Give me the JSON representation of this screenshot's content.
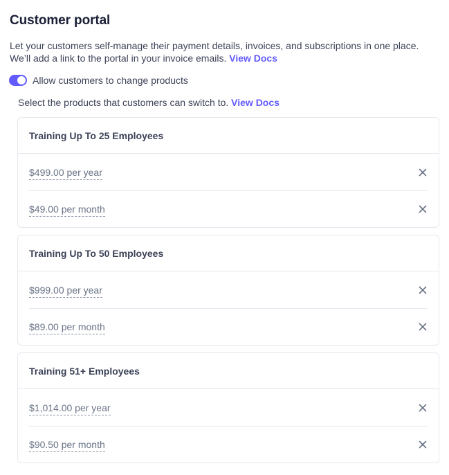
{
  "page": {
    "title": "Customer portal",
    "description": "Let your customers self-manage their payment details, invoices, and subscriptions in one place. We’ll add a link to the portal in your invoice emails.",
    "docs_link": "View Docs"
  },
  "toggle": {
    "label": "Allow customers to change products",
    "enabled": true,
    "accent": "#635bff"
  },
  "selection": {
    "text": "Select the products that customers can switch to.",
    "docs_link": "View Docs"
  },
  "products": [
    {
      "name": "Training Up To 25 Employees",
      "prices": [
        "$499.00 per year",
        "$49.00 per month"
      ]
    },
    {
      "name": "Training Up To 50 Employees",
      "prices": [
        "$999.00 per year",
        "$89.00 per month"
      ]
    },
    {
      "name": "Training 51+ Employees",
      "prices": [
        "$1,014.00 per year",
        "$90.50 per month"
      ]
    }
  ],
  "icons": {
    "remove": "close-icon"
  }
}
